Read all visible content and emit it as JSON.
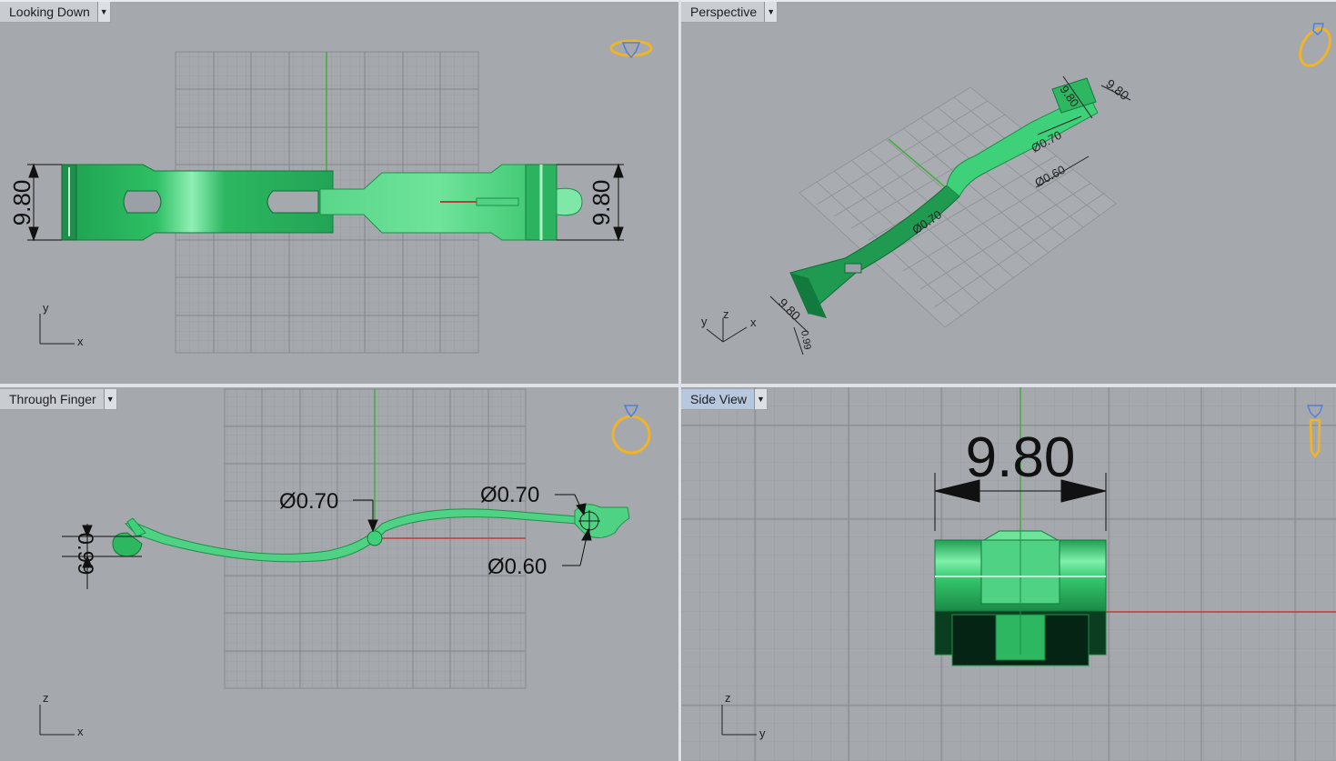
{
  "viewports": {
    "top_left": {
      "title": "Looking Down",
      "dim_left": "9.80",
      "dim_right": "9.80",
      "axis_h": "x",
      "axis_v": "y"
    },
    "top_right": {
      "title": "Perspective",
      "dim_a": "9.80",
      "dim_b": "9.80",
      "dim_c": "Ø0.70",
      "dim_d": "Ø0.60",
      "dim_e": "Ø0.70",
      "dim_f": "9.80",
      "dim_g": "0.99",
      "axis_x": "x",
      "axis_y": "y",
      "axis_z": "z"
    },
    "bottom_left": {
      "title": "Through Finger",
      "dim_thickness": "0.99",
      "dia_mid": "Ø0.70",
      "dia_right_top": "Ø0.70",
      "dia_right_bottom": "Ø0.60",
      "axis_h": "x",
      "axis_v": "z"
    },
    "bottom_right": {
      "title": "Side View",
      "dim_width": "9.80",
      "axis_h": "y",
      "axis_v": "z"
    }
  },
  "colors": {
    "viewport_bg": "#a5a8ac",
    "grid": "#8f9296",
    "model_green": "#2fc46a",
    "model_light": "#6fe39a",
    "axis_x": "#b8403c",
    "axis_y": "#3fae3f",
    "widget_gold": "#f0b428",
    "widget_blue": "#4f7fe0",
    "active_tab": "#b6c7de"
  },
  "icons": {
    "dropdown": "chevron-down-icon",
    "view_widget": "ring-gem-icon"
  }
}
